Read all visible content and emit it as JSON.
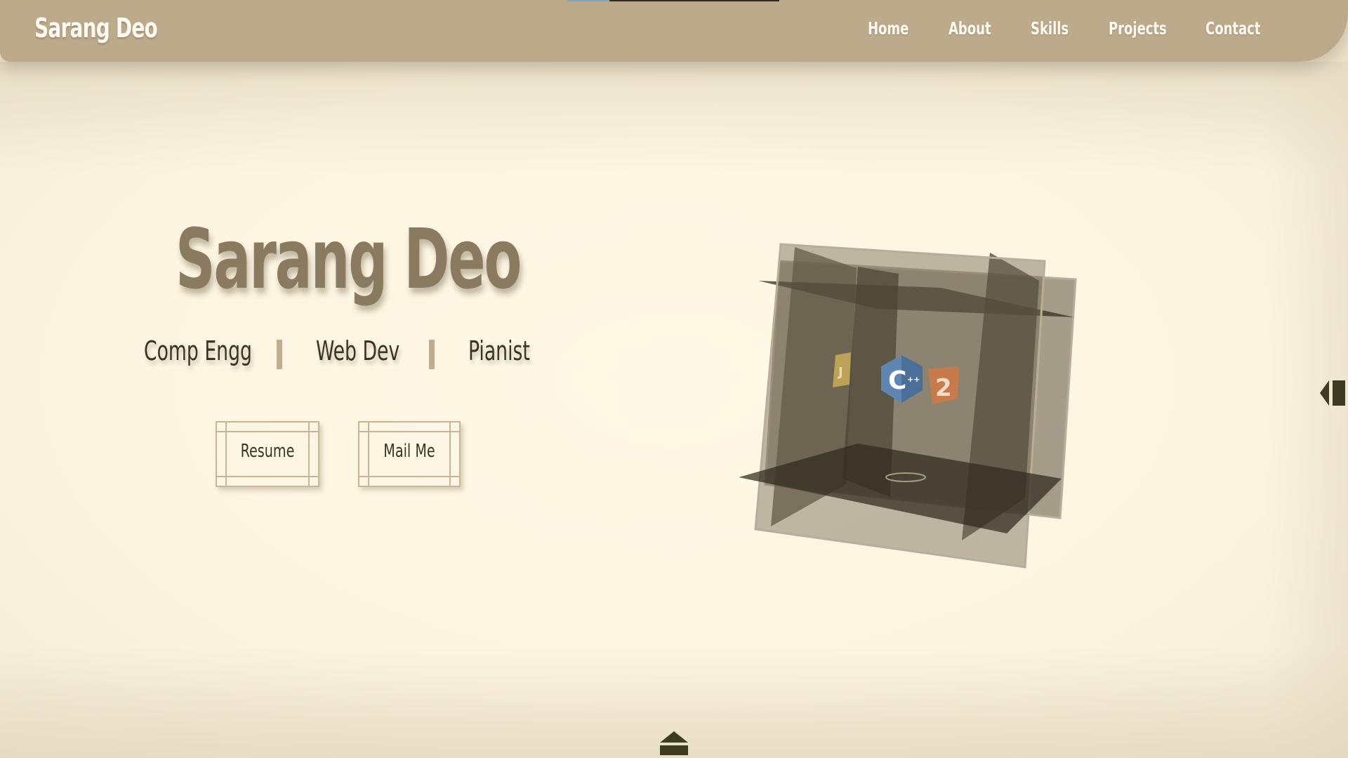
{
  "brand": {
    "name": "Sarang Deo"
  },
  "nav": {
    "items": [
      {
        "label": "Home"
      },
      {
        "label": "About"
      },
      {
        "label": "Skills"
      },
      {
        "label": "Projects"
      },
      {
        "label": "Contact"
      }
    ]
  },
  "hero": {
    "title": "Sarang Deo",
    "roles": [
      "Comp Engg",
      "Web Dev",
      "Pianist"
    ],
    "buttons": {
      "resume_label": "Resume",
      "mail_label": "Mail Me"
    }
  },
  "cube": {
    "icons": [
      "javascript-icon",
      "cpp-icon",
      "html5-icon"
    ]
  },
  "colors": {
    "navbar": "#bdaa8b",
    "background": "#fdf6e3",
    "title": "#8a7a5f",
    "text": "#3a3426",
    "accent_border": "#c9b596",
    "progress_fill": "#7fa3bf"
  },
  "controls": {
    "side_toggle_icon": "sidebar-toggle-icon",
    "scroll_up_icon": "scroll-top-icon"
  }
}
